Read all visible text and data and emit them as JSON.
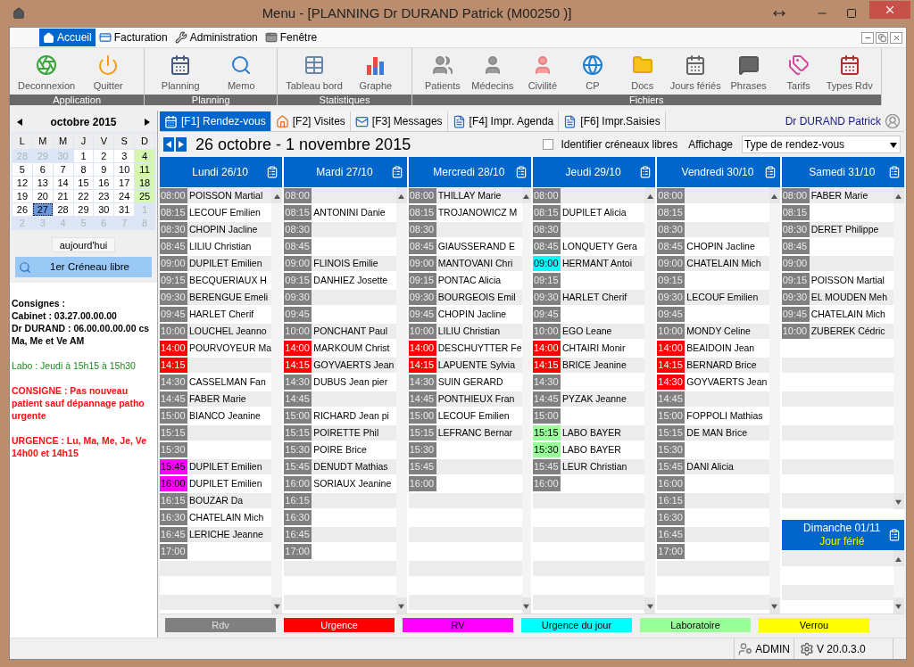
{
  "window": {
    "title": "Menu - [PLANNING Dr DURAND Patrick (M00250 )]"
  },
  "menu": [
    {
      "label": "Accueil",
      "selected": true
    },
    {
      "label": "Facturation",
      "selected": false
    },
    {
      "label": "Administration",
      "selected": false
    },
    {
      "label": "Fenêtre",
      "selected": false
    }
  ],
  "toolbar": {
    "groups": [
      {
        "label": "Application",
        "items": [
          {
            "label": "Deconnexion"
          },
          {
            "label": "Quitter"
          }
        ]
      },
      {
        "label": "Planning",
        "items": [
          {
            "label": "Planning"
          },
          {
            "label": "Memo"
          }
        ]
      },
      {
        "label": "Statistiques",
        "items": [
          {
            "label": "Tableau bord"
          },
          {
            "label": "Graphe"
          }
        ]
      },
      {
        "label": "Fichiers",
        "items": [
          {
            "label": "Patients"
          },
          {
            "label": "Médecins"
          },
          {
            "label": "Civilité"
          },
          {
            "label": "CP"
          },
          {
            "label": "Docs"
          },
          {
            "label": "Jours fériés"
          },
          {
            "label": "Phrases"
          },
          {
            "label": "Tarifs"
          },
          {
            "label": "Types Rdv"
          }
        ]
      }
    ]
  },
  "mini_calendar": {
    "month": "octobre 2015",
    "weekdays": [
      "L",
      "M",
      "M",
      "J",
      "V",
      "S",
      "D"
    ],
    "weeks": [
      [
        {
          "day": "28",
          "other_month": true,
          "selected": false
        },
        {
          "day": "29",
          "other_month": true,
          "selected": false
        },
        {
          "day": "30",
          "other_month": true,
          "selected": false
        },
        {
          "day": "1",
          "other_month": false,
          "selected": false
        },
        {
          "day": "2",
          "other_month": false,
          "selected": false
        },
        {
          "day": "3",
          "other_month": false,
          "selected": false
        },
        {
          "day": "4",
          "other_month": false,
          "selected": false
        }
      ],
      [
        {
          "day": "5",
          "other_month": false,
          "selected": false
        },
        {
          "day": "6",
          "other_month": false,
          "selected": false
        },
        {
          "day": "7",
          "other_month": false,
          "selected": false
        },
        {
          "day": "8",
          "other_month": false,
          "selected": false
        },
        {
          "day": "9",
          "other_month": false,
          "selected": false
        },
        {
          "day": "10",
          "other_month": false,
          "selected": false
        },
        {
          "day": "11",
          "other_month": false,
          "selected": false
        }
      ],
      [
        {
          "day": "12",
          "other_month": false,
          "selected": false
        },
        {
          "day": "13",
          "other_month": false,
          "selected": false
        },
        {
          "day": "14",
          "other_month": false,
          "selected": false
        },
        {
          "day": "15",
          "other_month": false,
          "selected": false
        },
        {
          "day": "16",
          "other_month": false,
          "selected": false
        },
        {
          "day": "17",
          "other_month": false,
          "selected": false
        },
        {
          "day": "18",
          "other_month": false,
          "selected": false
        }
      ],
      [
        {
          "day": "19",
          "other_month": false,
          "selected": false
        },
        {
          "day": "20",
          "other_month": false,
          "selected": false
        },
        {
          "day": "21",
          "other_month": false,
          "selected": false
        },
        {
          "day": "22",
          "other_month": false,
          "selected": false
        },
        {
          "day": "23",
          "other_month": false,
          "selected": false
        },
        {
          "day": "24",
          "other_month": false,
          "selected": false
        },
        {
          "day": "25",
          "other_month": false,
          "selected": false
        }
      ],
      [
        {
          "day": "26",
          "other_month": false,
          "selected": false
        },
        {
          "day": "27",
          "other_month": false,
          "selected": true
        },
        {
          "day": "28",
          "other_month": false,
          "selected": false
        },
        {
          "day": "29",
          "other_month": false,
          "selected": false
        },
        {
          "day": "30",
          "other_month": false,
          "selected": false
        },
        {
          "day": "31",
          "other_month": false,
          "selected": false
        },
        {
          "day": "1",
          "other_month": true,
          "selected": false
        }
      ],
      [
        {
          "day": "2",
          "other_month": true,
          "selected": false
        },
        {
          "day": "3",
          "other_month": true,
          "selected": false
        },
        {
          "day": "4",
          "other_month": true,
          "selected": false
        },
        {
          "day": "5",
          "other_month": true,
          "selected": false
        },
        {
          "day": "6",
          "other_month": true,
          "selected": false
        },
        {
          "day": "7",
          "other_month": true,
          "selected": false
        },
        {
          "day": "8",
          "other_month": true,
          "selected": false
        }
      ]
    ]
  },
  "buttons": {
    "today": "aujourd'hui",
    "first_slot": "1er Créneau libre"
  },
  "notes": [
    {
      "kind": "consignes",
      "lines": [
        "Consignes :",
        "Cabinet : 03.27.00.00.00",
        "Dr DURAND : 06.00.00.00.00 cs Ma, Me et Ve AM"
      ]
    },
    {
      "kind": "labo",
      "lines": [
        "Labo : Jeudi à 15h15 à 15h30"
      ]
    },
    {
      "kind": "alert",
      "lines": [
        "CONSIGNE : Pas nouveau patient sauf dépannage patho urgente"
      ]
    },
    {
      "kind": "alert",
      "lines": [
        "URGENCE : Lu, Ma, Me, Je, Ve 14h00 et 14h15"
      ]
    }
  ],
  "tabs": [
    {
      "label": "[F1] Rendez-vous",
      "selected": true
    },
    {
      "label": "[F2] Visites",
      "selected": false
    },
    {
      "label": "[F3] Messages",
      "selected": false
    },
    {
      "label": "[F4] Impr. Agenda",
      "selected": false
    },
    {
      "label": "[F6] Impr.Saisies",
      "selected": false
    }
  ],
  "doctor": "Dr DURAND Patrick",
  "week": {
    "range": "26 octobre - 1 novembre 2015"
  },
  "free_slots_checkbox": {
    "label": "Identifier créneaux libres",
    "checked": false
  },
  "display": {
    "label": "Affichage",
    "value": "Type de rendez-vous"
  },
  "days": [
    {
      "label": "Lundi 26/10",
      "slots": [
        {
          "time": "08:00",
          "kind": "rdv",
          "name": "POISSON Martial"
        },
        {
          "time": "08:15",
          "kind": "rdv",
          "name": "LECOUF Emilien"
        },
        {
          "time": "08:30",
          "kind": "rdv",
          "name": "CHOPIN Jacline"
        },
        {
          "time": "08:45",
          "kind": "rdv",
          "name": "LILIU Christian"
        },
        {
          "time": "09:00",
          "kind": "rdv",
          "name": "DUPILET Emilien"
        },
        {
          "time": "09:15",
          "kind": "rdv",
          "name": "BECQUERIAUX H"
        },
        {
          "time": "09:30",
          "kind": "rdv",
          "name": "BERENGUE Emeli"
        },
        {
          "time": "09:45",
          "kind": "rdv",
          "name": "HARLET Cherif"
        },
        {
          "time": "10:00",
          "kind": "rdv",
          "name": "LOUCHEL Jeanno"
        },
        {
          "time": "14:00",
          "kind": "urgence",
          "name": "POURVOYEUR Ma"
        },
        {
          "time": "14:15",
          "kind": "urgence"
        },
        {
          "time": "14:30",
          "kind": "rdv",
          "name": "CASSELMAN Fan"
        },
        {
          "time": "14:45",
          "kind": "rdv",
          "name": "FABER Marie"
        },
        {
          "time": "15:00",
          "kind": "rdv",
          "name": "BIANCO Jeanine"
        },
        {
          "time": "15:15",
          "kind": "rdv"
        },
        {
          "time": "15:30",
          "kind": "rdv"
        },
        {
          "time": "15:45",
          "kind": "rv",
          "name": "DUPILET Emilien"
        },
        {
          "time": "16:00",
          "kind": "rv",
          "name": "DUPILET Emilien"
        },
        {
          "time": "16:15",
          "kind": "rdv",
          "name": "BOUZAR Da"
        },
        {
          "time": "16:30",
          "kind": "rdv",
          "name": "CHATELAIN Mich"
        },
        {
          "time": "16:45",
          "kind": "rdv",
          "name": "LERICHE Jeanne"
        },
        {
          "time": "17:00",
          "kind": "rdv"
        }
      ]
    },
    {
      "label": "Mardi 27/10",
      "slots": [
        {
          "time": "08:00",
          "kind": "rdv"
        },
        {
          "time": "08:15",
          "kind": "rdv",
          "name": "ANTONINI Danie"
        },
        {
          "time": "08:30",
          "kind": "rdv"
        },
        {
          "time": "08:45",
          "kind": "rdv"
        },
        {
          "time": "09:00",
          "kind": "rdv",
          "name": "FLINOIS Emilie"
        },
        {
          "time": "09:15",
          "kind": "rdv",
          "name": "DANHIEZ Josette"
        },
        {
          "time": "09:30",
          "kind": "rdv"
        },
        {
          "time": "09:45",
          "kind": "rdv"
        },
        {
          "time": "10:00",
          "kind": "rdv",
          "name": "PONCHANT Paul"
        },
        {
          "time": "14:00",
          "kind": "urgence",
          "name": "MARKOUM Christ"
        },
        {
          "time": "14:15",
          "kind": "urgence",
          "name": "GOYVAERTS Jean"
        },
        {
          "time": "14:30",
          "kind": "rdv",
          "name": "DUBUS Jean pier"
        },
        {
          "time": "14:45",
          "kind": "rdv"
        },
        {
          "time": "15:00",
          "kind": "rdv",
          "name": "RICHARD Jean pi"
        },
        {
          "time": "15:15",
          "kind": "rdv",
          "name": "POIRETTE Phil"
        },
        {
          "time": "15:30",
          "kind": "rdv",
          "name": "POIRE Brice"
        },
        {
          "time": "15:45",
          "kind": "rdv",
          "name": "DENUDT Mathias"
        },
        {
          "time": "16:00",
          "kind": "rdv",
          "name": "SORIAUX Jeanine"
        },
        {
          "time": "16:15",
          "kind": "rdv"
        },
        {
          "time": "16:30",
          "kind": "rdv"
        },
        {
          "time": "16:45",
          "kind": "rdv"
        },
        {
          "time": "17:00",
          "kind": "rdv"
        }
      ]
    },
    {
      "label": "Mercredi 28/10",
      "slots": [
        {
          "time": "08:00",
          "kind": "rdv",
          "name": "THILLAY Marie"
        },
        {
          "time": "08:15",
          "kind": "rdv",
          "name": "TROJANOWICZ M"
        },
        {
          "time": "08:30",
          "kind": "rdv"
        },
        {
          "time": "08:45",
          "kind": "rdv",
          "name": "GIAUSSERAND E"
        },
        {
          "time": "09:00",
          "kind": "rdv",
          "name": "MANTOVANI Chri"
        },
        {
          "time": "09:15",
          "kind": "rdv",
          "name": "PONTAC Alicia"
        },
        {
          "time": "09:30",
          "kind": "rdv",
          "name": "BOURGEOIS Emil"
        },
        {
          "time": "09:45",
          "kind": "rdv",
          "name": "CHOPIN Jacline"
        },
        {
          "time": "10:00",
          "kind": "rdv",
          "name": "LILIU Christian"
        },
        {
          "time": "14:00",
          "kind": "urgence",
          "name": "DESCHUYTTER Fe"
        },
        {
          "time": "14:15",
          "kind": "urgence",
          "name": "LAPUENTE Sylvia"
        },
        {
          "time": "14:30",
          "kind": "rdv",
          "name": "SUIN GERARD"
        },
        {
          "time": "14:45",
          "kind": "rdv",
          "name": "PONTHIEUX Fran"
        },
        {
          "time": "15:00",
          "kind": "rdv",
          "name": "LECOUF Emilien"
        },
        {
          "time": "15:15",
          "kind": "rdv",
          "name": "LEFRANC Bernar"
        },
        {
          "time": "15:30",
          "kind": "rdv"
        },
        {
          "time": "15:45",
          "kind": "rdv"
        },
        {
          "time": "16:00",
          "kind": "rdv"
        }
      ]
    },
    {
      "label": "Jeudi 29/10",
      "slots": [
        {
          "time": "08:00",
          "kind": "rdv"
        },
        {
          "time": "08:15",
          "kind": "rdv",
          "name": "DUPILET Alicia"
        },
        {
          "time": "08:30",
          "kind": "rdv"
        },
        {
          "time": "08:45",
          "kind": "rdv",
          "name": "LONQUETY Gera"
        },
        {
          "time": "09:00",
          "kind": "urgence_du_jour",
          "name": "HERMANT Antoi"
        },
        {
          "time": "09:15",
          "kind": "rdv"
        },
        {
          "time": "09:30",
          "kind": "rdv",
          "name": "HARLET Cherif"
        },
        {
          "time": "09:45",
          "kind": "rdv"
        },
        {
          "time": "10:00",
          "kind": "rdv",
          "name": "EGO Leane"
        },
        {
          "time": "14:00",
          "kind": "urgence",
          "name": "CHTAIRI Monir"
        },
        {
          "time": "14:15",
          "kind": "urgence",
          "name": "BRICE Jeanine"
        },
        {
          "time": "14:30",
          "kind": "rdv"
        },
        {
          "time": "14:45",
          "kind": "rdv",
          "name": "PYZAK Jeanne"
        },
        {
          "time": "15:00",
          "kind": "rdv"
        },
        {
          "time": "15:15",
          "kind": "laboratoire",
          "name": "LABO BAYER"
        },
        {
          "time": "15:30",
          "kind": "laboratoire",
          "name": "LABO BAYER"
        },
        {
          "time": "15:45",
          "kind": "rdv",
          "name": "LEUR Christian"
        },
        {
          "time": "16:00",
          "kind": "rdv"
        }
      ]
    },
    {
      "label": "Vendredi 30/10",
      "slots": [
        {
          "time": "08:00",
          "kind": "rdv"
        },
        {
          "time": "08:15",
          "kind": "rdv"
        },
        {
          "time": "08:30",
          "kind": "rdv"
        },
        {
          "time": "08:45",
          "kind": "rdv",
          "name": "CHOPIN Jacline"
        },
        {
          "time": "09:00",
          "kind": "rdv",
          "name": "CHATELAIN Mich"
        },
        {
          "time": "09:15",
          "kind": "rdv"
        },
        {
          "time": "09:30",
          "kind": "rdv",
          "name": "LECOUF Emilien"
        },
        {
          "time": "09:45",
          "kind": "rdv"
        },
        {
          "time": "10:00",
          "kind": "rdv",
          "name": "MONDY Celine"
        },
        {
          "time": "14:00",
          "kind": "urgence",
          "name": "BEAIDOIN Jean"
        },
        {
          "time": "14:15",
          "kind": "urgence",
          "name": "BERNARD Brice"
        },
        {
          "time": "14:30",
          "kind": "urgence",
          "name": "GOYVAERTS Jean"
        },
        {
          "time": "14:45",
          "kind": "rdv"
        },
        {
          "time": "15:00",
          "kind": "rdv",
          "name": "FOPPOLI Mathias"
        },
        {
          "time": "15:15",
          "kind": "rdv",
          "name": "DE MAN Brice"
        },
        {
          "time": "15:30",
          "kind": "rdv"
        },
        {
          "time": "15:45",
          "kind": "rdv",
          "name": "DANI Alicia"
        },
        {
          "time": "16:00",
          "kind": "rdv"
        },
        {
          "time": "16:15",
          "kind": "rdv"
        },
        {
          "time": "16:30",
          "kind": "rdv"
        },
        {
          "time": "16:45",
          "kind": "rdv"
        },
        {
          "time": "17:00",
          "kind": "rdv"
        }
      ]
    },
    {
      "label": "Samedi 31/10",
      "slots": [
        {
          "time": "08:00",
          "kind": "rdv",
          "name": "FABER Marie"
        },
        {
          "time": "08:15",
          "kind": "rdv"
        },
        {
          "time": "08:30",
          "kind": "rdv",
          "name": "DERET Philippe"
        },
        {
          "time": "08:45",
          "kind": "rdv"
        },
        {
          "time": "09:00",
          "kind": "rdv"
        },
        {
          "time": "09:15",
          "kind": "rdv",
          "name": "POISSON Martial"
        },
        {
          "time": "09:30",
          "kind": "rdv",
          "name": "EL MOUDEN Meh"
        },
        {
          "time": "09:45",
          "kind": "rdv",
          "name": "CHATELAIN Mich"
        },
        {
          "time": "10:00",
          "kind": "rdv",
          "name": "ZUBEREK Cédric"
        }
      ]
    },
    {
      "label": "Dimanche 01/11",
      "note": "Jour férié"
    }
  ],
  "legend": [
    {
      "label": "Rdv",
      "color": "#808080"
    },
    {
      "label": "Urgence",
      "color": "#ff0000"
    },
    {
      "label": "RV",
      "color": "#ff00ff"
    },
    {
      "label": "Urgence du jour",
      "color": "#00ffff"
    },
    {
      "label": "Laboratoire",
      "color": "#99ff99"
    },
    {
      "label": "Verrou",
      "color": "#ffff00"
    }
  ],
  "status_bar": {
    "user": "ADMIN",
    "version": "V 20.0.3.0"
  }
}
